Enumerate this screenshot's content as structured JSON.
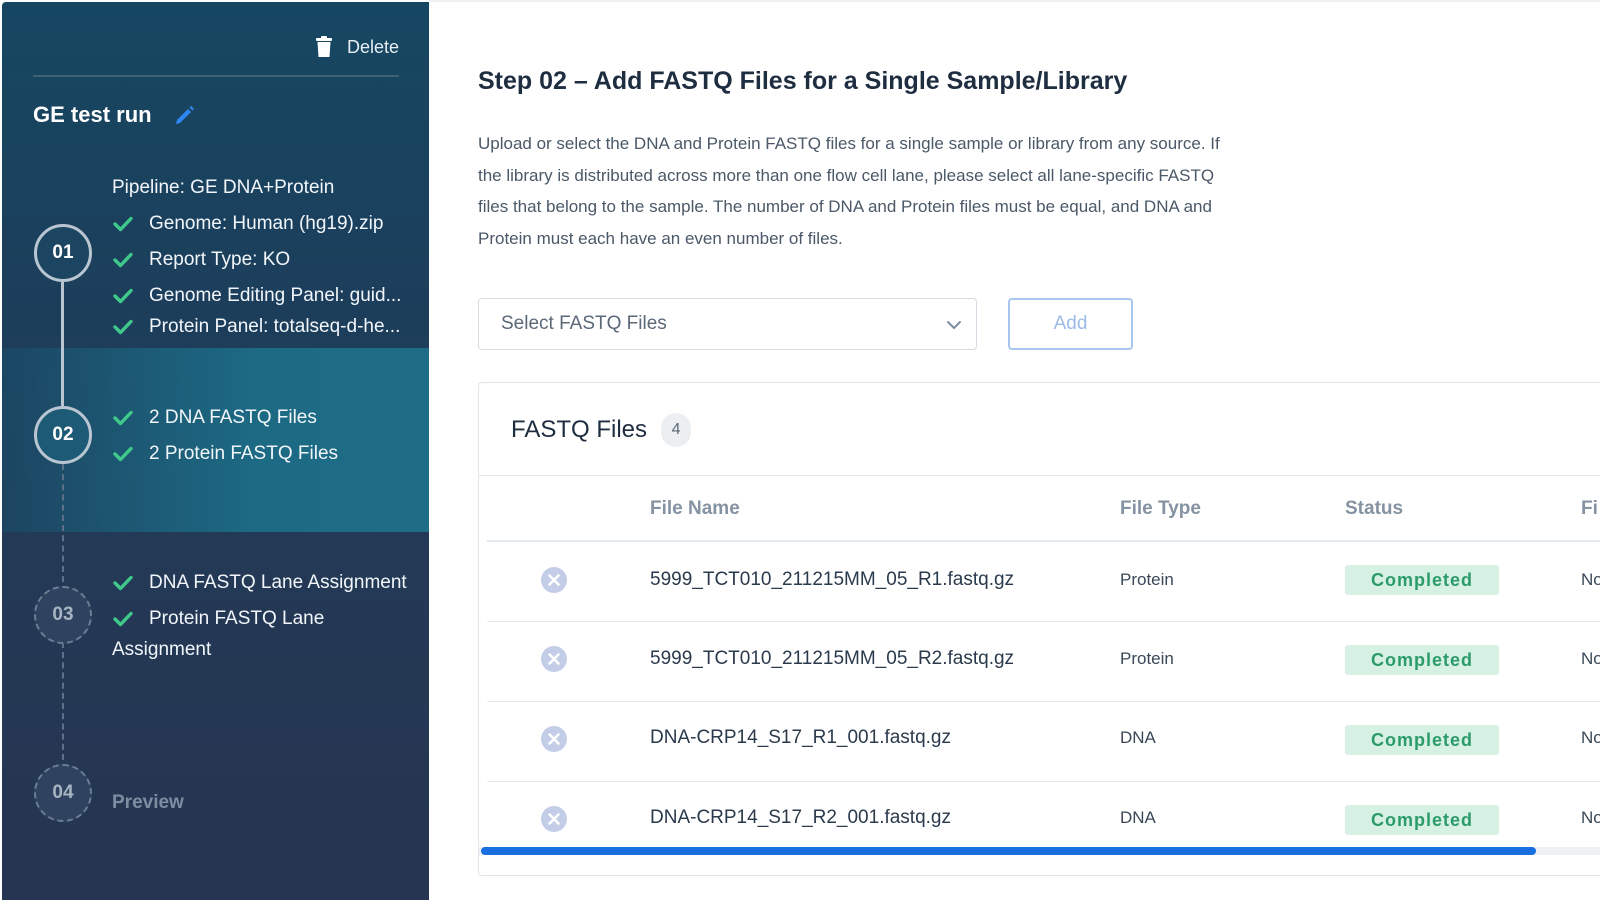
{
  "sidebar": {
    "delete_label": "Delete",
    "run_title": "GE test run",
    "steps": [
      {
        "number": "01",
        "heading": "Pipeline: GE DNA+Protein",
        "items": [
          "Genome: Human (hg19).zip",
          "Report Type: KO",
          "Genome Editing Panel: guid...",
          "Protein Panel: totalseq-d-he..."
        ]
      },
      {
        "number": "02",
        "items": [
          "2 DNA FASTQ Files",
          "2 Protein FASTQ Files"
        ]
      },
      {
        "number": "03",
        "items": [
          "DNA FASTQ Lane Assignment",
          "Protein FASTQ Lane"
        ],
        "continuation": "Assignment"
      },
      {
        "number": "04",
        "label": "Preview"
      }
    ]
  },
  "main": {
    "title": "Step 02 – Add FASTQ Files for a Single Sample/Library",
    "description": "Upload or select the DNA and Protein FASTQ files for a single sample or library from any source. If the library is distributed across more than one flow cell lane, please select all lane-specific FASTQ files that belong to the sample. The number of DNA and Protein files must be equal, and DNA and Protein must each have an even number of files.",
    "select_placeholder": "Select FASTQ Files",
    "add_label": "Add",
    "files_card": {
      "title": "FASTQ Files",
      "count": "4",
      "columns": [
        "File Name",
        "File Type",
        "Status",
        "Fi"
      ],
      "rows": [
        {
          "name": "5999_TCT010_211215MM_05_R1.fastq.gz",
          "type": "Protein",
          "status": "Completed",
          "extra": "No"
        },
        {
          "name": "5999_TCT010_211215MM_05_R2.fastq.gz",
          "type": "Protein",
          "status": "Completed",
          "extra": "No"
        },
        {
          "name": "DNA-CRP14_S17_R1_001.fastq.gz",
          "type": "DNA",
          "status": "Completed",
          "extra": "No"
        },
        {
          "name": "DNA-CRP14_S17_R2_001.fastq.gz",
          "type": "DNA",
          "status": "Completed",
          "extra": "No"
        }
      ]
    }
  },
  "colors": {
    "accent": "#1a6fe0",
    "success": "#2c9b6a",
    "success_bg": "#d6f1e3",
    "check": "#3fc98a"
  }
}
